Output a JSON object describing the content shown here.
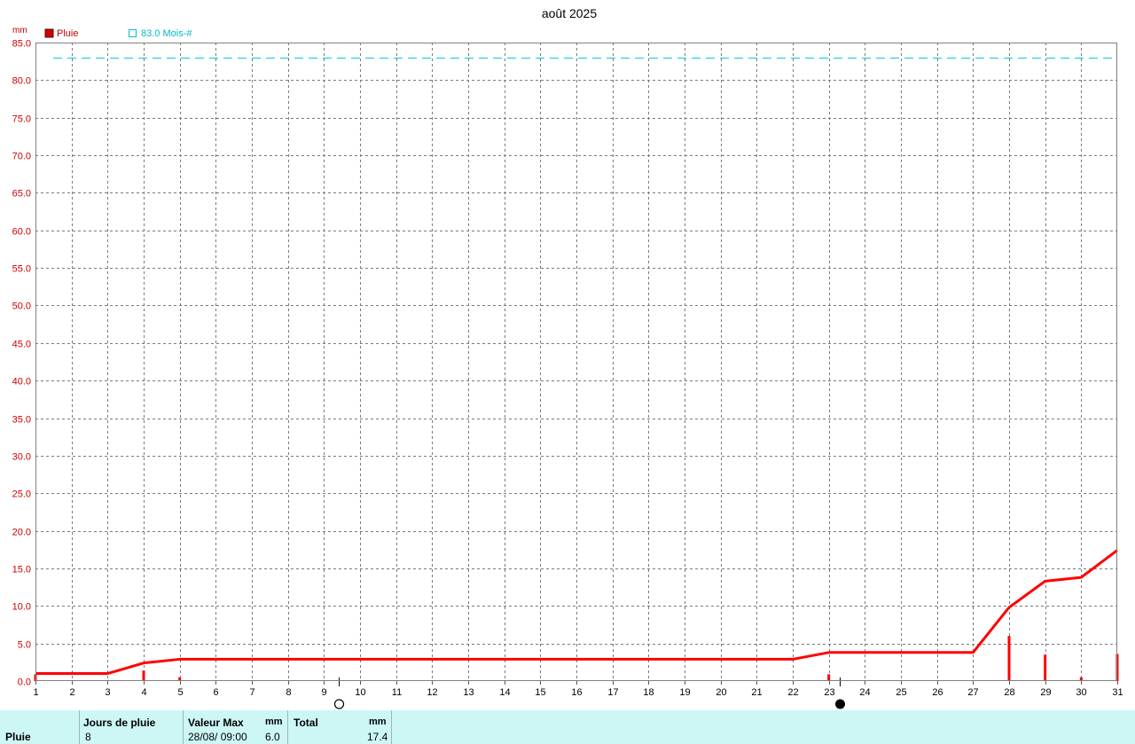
{
  "chart_data": {
    "type": "line",
    "title": "août 2025",
    "ylabel": "mm",
    "ylim": [
      0,
      85
    ],
    "ytick_step": 5,
    "yticks": [
      "0.0",
      "5.0",
      "10.0",
      "15.0",
      "20.0",
      "25.0",
      "30.0",
      "35.0",
      "40.0",
      "45.0",
      "50.0",
      "55.0",
      "60.0",
      "65.0",
      "70.0",
      "75.0",
      "80.0",
      "85.0"
    ],
    "x": [
      1,
      2,
      3,
      4,
      5,
      6,
      7,
      8,
      9,
      10,
      11,
      12,
      13,
      14,
      15,
      16,
      17,
      18,
      19,
      20,
      21,
      22,
      23,
      24,
      25,
      26,
      27,
      28,
      29,
      30,
      31
    ],
    "xlim": [
      1,
      31
    ],
    "grid": true,
    "legend_position": "top-left",
    "series": [
      {
        "name": "Pluie",
        "kind": "cumulative-line",
        "color": "#ff0000",
        "points": [
          [
            1,
            1.0
          ],
          [
            3,
            1.0
          ],
          [
            4,
            2.4
          ],
          [
            5,
            2.9
          ],
          [
            22,
            2.9
          ],
          [
            23,
            3.8
          ],
          [
            27,
            3.8
          ],
          [
            28,
            9.8
          ],
          [
            29,
            13.3
          ],
          [
            30,
            13.8
          ],
          [
            31,
            17.4
          ]
        ]
      },
      {
        "name": "Pluie",
        "kind": "daily-bars",
        "color": "#ff0000",
        "points": [
          [
            1,
            0.9
          ],
          [
            4,
            1.4
          ],
          [
            5,
            0.5
          ],
          [
            23,
            0.9
          ],
          [
            28,
            6.0
          ],
          [
            29,
            3.5
          ],
          [
            30,
            0.5
          ],
          [
            31,
            3.6
          ]
        ]
      }
    ],
    "reference": {
      "label": "83.0 Mois-#",
      "value": 83.0,
      "color": "#00d0d8"
    },
    "moon_markers": [
      {
        "x": 9.4,
        "icon": "full-moon-icon"
      },
      {
        "x": 23.3,
        "icon": "new-moon-icon"
      }
    ]
  },
  "legend": {
    "rain_label": "Pluie",
    "reference_label": "83.0 Mois-#"
  },
  "summary": {
    "row_label": "Pluie",
    "rain_days_header": "Jours de pluie",
    "rain_days_value": "8",
    "max_header": "Valeur Max",
    "max_unit": "mm",
    "max_date": "28/08/  09:00",
    "max_value": "6.0",
    "total_header": "Total",
    "total_unit": "mm",
    "total_value": "17.4",
    "background": "#ccf7f5"
  }
}
